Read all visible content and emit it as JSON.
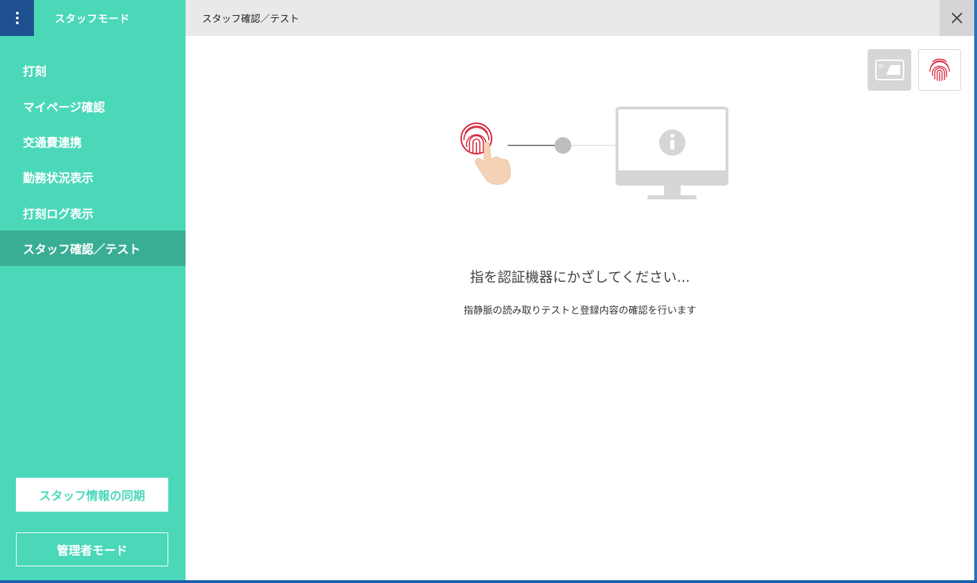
{
  "sidebar": {
    "mode_title": "スタッフモード",
    "items": [
      {
        "label": "打刻"
      },
      {
        "label": "マイページ確認"
      },
      {
        "label": "交通費連携"
      },
      {
        "label": "勤務状況表示"
      },
      {
        "label": "打刻ログ表示"
      },
      {
        "label": "スタッフ確認／テスト",
        "active": true
      }
    ],
    "sync_label": "スタッフ情報の同期",
    "admin_label": "管理者モード"
  },
  "header": {
    "title": "スタッフ確認／テスト"
  },
  "auth_buttons": {
    "ic_card_label": "IC"
  },
  "main": {
    "prompt": "指を認証機器にかざしてください...",
    "description": "指静脈の読み取りテストと登録内容の確認を行います"
  },
  "colors": {
    "sidebar": "#4bd8b9",
    "sidebar_active": "#3aae94",
    "menu_button": "#1e4f8f",
    "fingerprint": "#d9233c"
  },
  "icons": {
    "menu": "vertical-dots-icon",
    "close": "close-icon",
    "ic_card": "ic-card-icon",
    "fingerprint": "fingerprint-icon",
    "monitor": "monitor-info-icon",
    "hand": "pointing-hand-icon"
  }
}
